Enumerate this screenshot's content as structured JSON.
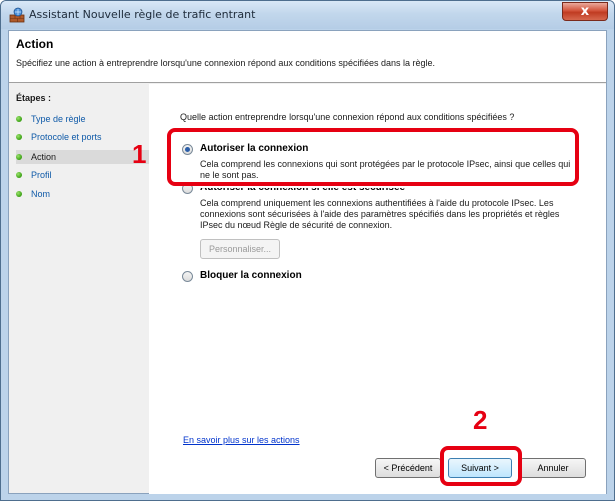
{
  "window": {
    "title": "Assistant Nouvelle règle de trafic entrant",
    "close_label": "x"
  },
  "header": {
    "title": "Action",
    "description": "Spécifiez une action à entreprendre lorsqu'une connexion répond aux conditions spécifiées dans la règle."
  },
  "steps": {
    "label": "Étapes :",
    "items": [
      {
        "label": "Type de règle"
      },
      {
        "label": "Protocole et ports"
      },
      {
        "label": "Action"
      },
      {
        "label": "Profil"
      },
      {
        "label": "Nom"
      }
    ]
  },
  "main": {
    "question": "Quelle action entreprendre lorsqu'une connexion répond aux conditions spécifiées ?",
    "options": [
      {
        "label": "Autoriser la connexion",
        "description_lines": [
          "Cela comprend les connexions qui sont protégées par le protocole IPsec, ainsi que celles qui",
          "ne le sont pas."
        ],
        "selected": true
      },
      {
        "label": "Autoriser la connexion si elle est sécurisée",
        "description_lines": [
          "Cela comprend uniquement les connexions authentifiées à l'aide du protocole IPsec. Les",
          "connexions sont sécurisées à l'aide des paramètres spécifiés dans les propriétés et règles",
          "IPsec du nœud Règle de sécurité de connexion."
        ],
        "selected": false
      },
      {
        "label": "Bloquer la connexion",
        "description_lines": [],
        "selected": false
      }
    ],
    "customize_button": "Personnaliser...",
    "learn_more_link": "En savoir plus sur les actions"
  },
  "footer": {
    "previous_button": "< Précédent",
    "next_button": "Suivant >",
    "cancel_button": "Annuler"
  },
  "annotations": {
    "marker_1": "1",
    "marker_2": "2",
    "highlight_color": "#e60012"
  }
}
